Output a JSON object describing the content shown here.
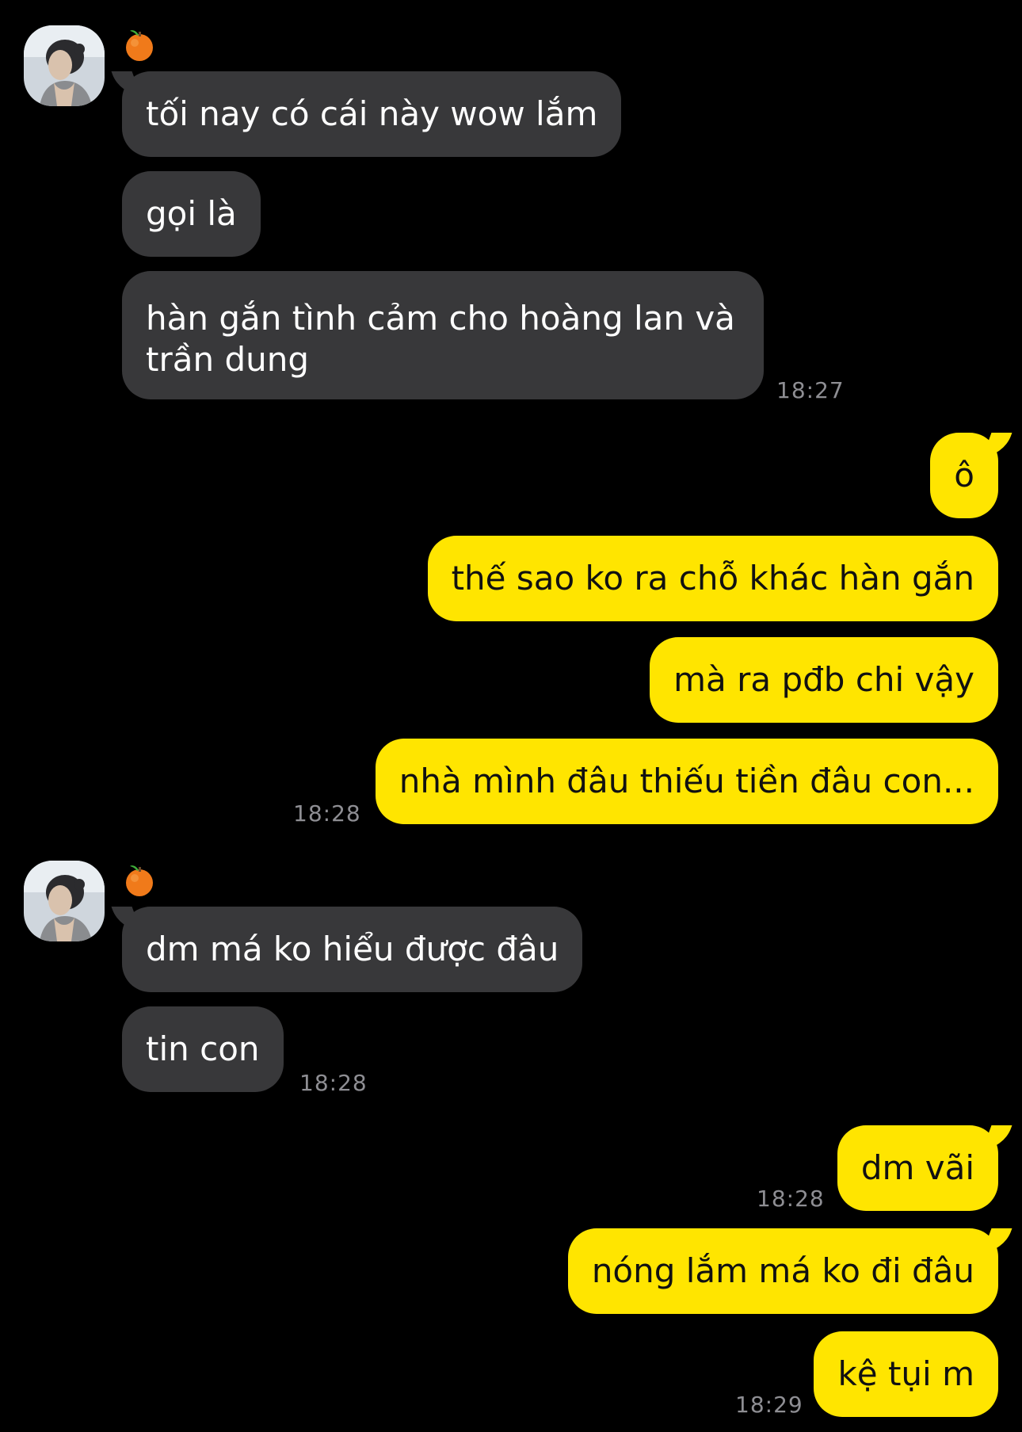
{
  "app": {
    "theme_colors": {
      "background": "#000000",
      "incoming_bubble": "#38383a",
      "outgoing_bubble": "#ffe500",
      "timestamp": "#8e8e93"
    }
  },
  "contact": {
    "avatar_icon": "profile-photo-avatar",
    "badge_emoji": "🍊",
    "badge_icon": "tangerine-icon"
  },
  "messages": {
    "m1": {
      "text": "tối nay có cái này wow lắm",
      "direction": "incoming"
    },
    "m2": {
      "text": "gọi là",
      "direction": "incoming"
    },
    "m3": {
      "text": "hàn gắn tình cảm cho hoàng lan và trần dung",
      "direction": "incoming"
    },
    "m4": {
      "text": "ô",
      "direction": "outgoing"
    },
    "m5": {
      "text": "thế sao ko ra chỗ khác hàn gắn",
      "direction": "outgoing"
    },
    "m6": {
      "text": "mà ra pđb chi vậy",
      "direction": "outgoing"
    },
    "m7": {
      "text": "nhà mình đâu thiếu tiền đâu con...",
      "direction": "outgoing"
    },
    "m8": {
      "text": "dm má ko hiểu được đâu",
      "direction": "incoming"
    },
    "m9": {
      "text": "tin con",
      "direction": "incoming"
    },
    "m10": {
      "text": "dm vãi",
      "direction": "outgoing"
    },
    "m11": {
      "text": "nóng lắm má ko đi đâu",
      "direction": "outgoing"
    },
    "m12": {
      "text": "kệ tụi m",
      "direction": "outgoing"
    }
  },
  "timestamps": {
    "t1": "18:27",
    "t2": "18:28",
    "t3": "18:28",
    "t4": "18:28",
    "t5": "18:29"
  }
}
